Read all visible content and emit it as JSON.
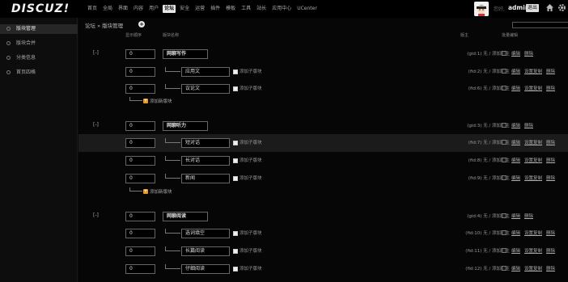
{
  "logo": "DISCUZ!",
  "nav": [
    "首页",
    "全局",
    "界面",
    "内容",
    "用户",
    "论坛",
    "安全",
    "运营",
    "插件",
    "模板",
    "工具",
    "站长",
    "应用中心",
    "UCenter"
  ],
  "nav_active": 5,
  "user": {
    "greet": "您好,",
    "name": "admin",
    "logout": "退出"
  },
  "sidebar": {
    "items": [
      "版块管理",
      "版块合并",
      "分类信息",
      "首页四格"
    ],
    "active": 0
  },
  "breadcrumb": "论坛 » 版块管理",
  "columns": {
    "order": "显示顺序",
    "name": "版块名称",
    "moderator": "版主",
    "ops": "批量编辑"
  },
  "labels": {
    "add_sub": "添加子版块",
    "add_forum": "添加新版块",
    "edit": "编辑",
    "delete": "删除",
    "copy": "设置复制"
  },
  "rows": [
    {
      "type": "group",
      "order": "0",
      "name": "网聊写作",
      "fid": "(gid:1) 无 / 添加版主",
      "toggle": "[-]"
    },
    {
      "type": "forum",
      "order": "0",
      "name": "应用文",
      "fid": "(fid:2) 无 / 添加版主"
    },
    {
      "type": "forum",
      "order": "0",
      "name": "议论文",
      "fid": "(fid:6) 无 / 添加版主"
    },
    {
      "type": "addforum"
    },
    {
      "type": "group",
      "order": "0",
      "name": "网聊听力",
      "fid": "(gid:3) 无 / 添加版主",
      "toggle": "[-]"
    },
    {
      "type": "forum",
      "order": "0",
      "name": "短对话",
      "fid": "(fid:7) 无 / 添加版主",
      "selected": true
    },
    {
      "type": "forum",
      "order": "0",
      "name": "长对话",
      "fid": "(fid:8) 无 / 添加版主"
    },
    {
      "type": "forum",
      "order": "0",
      "name": "新闻",
      "fid": "(fid:9) 无 / 添加版主"
    },
    {
      "type": "addforum"
    },
    {
      "type": "group",
      "order": "0",
      "name": "网聊阅读",
      "fid": "(gid:4) 无 / 添加版主",
      "toggle": "[-]"
    },
    {
      "type": "forum",
      "order": "0",
      "name": "选词填空",
      "fid": "(fid:10) 无 / 添加版主"
    },
    {
      "type": "forum",
      "order": "0",
      "name": "长篇阅读",
      "fid": "(fid:11) 无 / 添加版主"
    },
    {
      "type": "forum",
      "order": "0",
      "name": "仔细阅读",
      "fid": "(fid:12) 无 / 添加版主"
    }
  ]
}
